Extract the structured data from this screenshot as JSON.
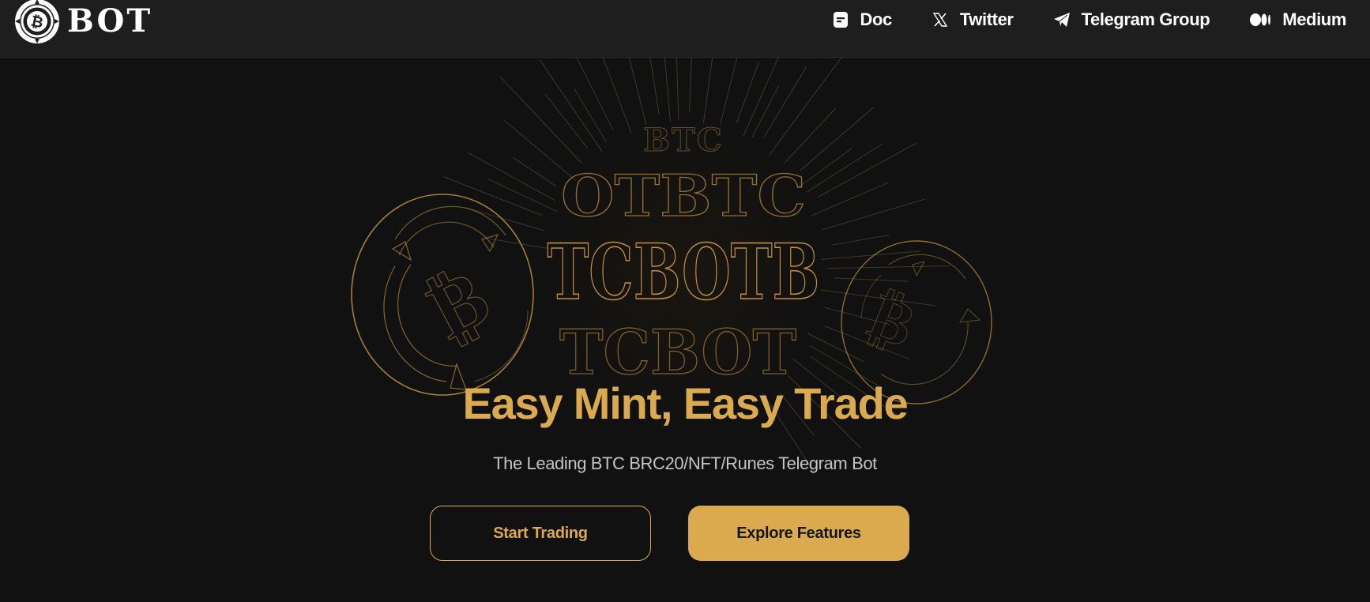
{
  "brand": {
    "name": "BOT",
    "logo_icon": "bitcoin-coin-icon",
    "accent_color": "#dbaa4f"
  },
  "nav": {
    "items": [
      {
        "label": "Doc",
        "icon": "document-icon"
      },
      {
        "label": "Twitter",
        "icon": "x-twitter-icon"
      },
      {
        "label": "Telegram Group",
        "icon": "telegram-icon"
      },
      {
        "label": "Medium",
        "icon": "medium-icon"
      }
    ]
  },
  "hero": {
    "sphere_rows": [
      "OTBTC",
      "TCBOTB",
      "TCBOT"
    ],
    "title": "Easy Mint, Easy Trade",
    "subtitle": "The Leading BTC BRC20/NFT/Runes Telegram Bot",
    "primary_button": "Start Trading",
    "secondary_button": "Explore Features"
  }
}
